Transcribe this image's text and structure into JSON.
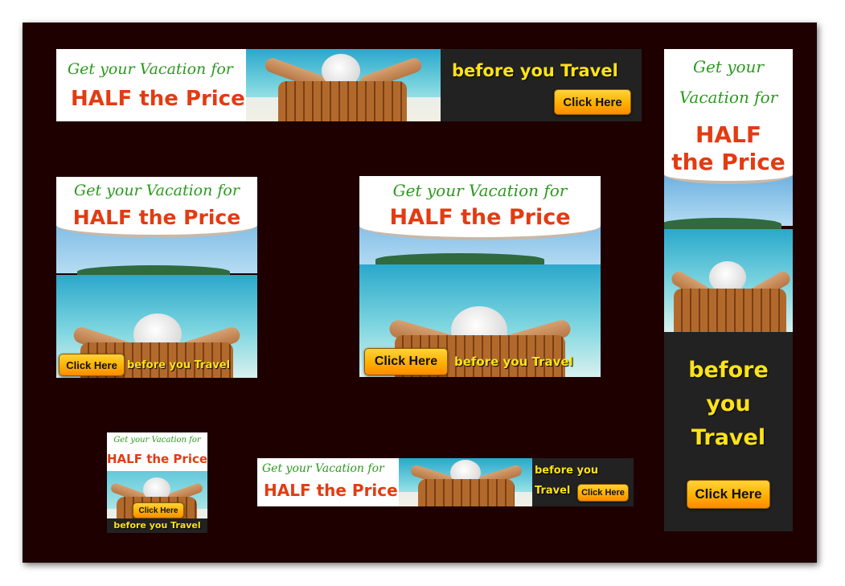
{
  "colors": {
    "background": "#1e0000",
    "headline_green": "#2b9a1e",
    "headline_red": "#e33b12",
    "travel_yellow": "#ffe21a",
    "button_orange": "#ffb000",
    "dark_panel": "#222222"
  },
  "ads": {
    "leaderboard": {
      "line1": "Get your Vacation for",
      "line2": "HALF the Price",
      "travel": "before you Travel",
      "button": "Click Here"
    },
    "skyscraper": {
      "line1a": "Get your",
      "line1b": "Vacation for",
      "line2a": "HALF",
      "line2b": "the Price",
      "travel_a": "before",
      "travel_b": "you",
      "travel_c": "Travel",
      "button": "Click Here"
    },
    "square": {
      "line1": "Get your Vacation for",
      "line2": "HALF the Price",
      "travel": "before you Travel",
      "button": "Click Here"
    },
    "rectangle": {
      "line1": "Get your Vacation for",
      "line2": "HALF the Price",
      "travel": "before you Travel",
      "button": "Click Here"
    },
    "small_square": {
      "line1": "Get your Vacation for",
      "line2": "HALF the Price",
      "travel": "before you Travel",
      "button": "Click Here"
    },
    "banner": {
      "line1": "Get your Vacation for",
      "line2": "HALF the Price",
      "travel_a": "before you",
      "travel_b": "Travel",
      "button": "Click Here"
    }
  }
}
